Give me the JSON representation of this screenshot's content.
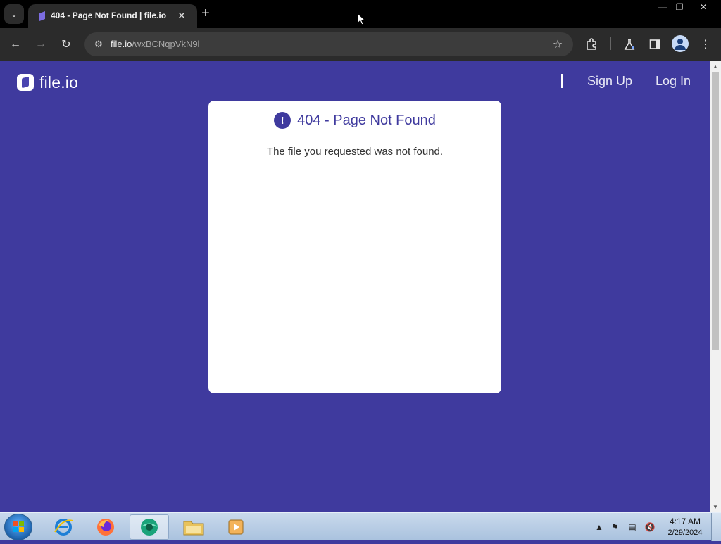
{
  "browser": {
    "tab_title": "404 - Page Not Found | file.io",
    "url_host": "file.io",
    "url_path": "/wxBCNqpVkN9l"
  },
  "site": {
    "logo_text": "file.io",
    "nav": {
      "sign_up": "Sign Up",
      "log_in": "Log In"
    },
    "error": {
      "icon_glyph": "!",
      "title": "404 - Page Not Found",
      "message": "The file you requested was not found."
    },
    "colors": {
      "brand_background": "#3f3a9e",
      "card_background": "#ffffff"
    }
  },
  "taskbar": {
    "apps": [
      "internet-explorer",
      "firefox",
      "browser-active",
      "file-explorer",
      "media-player"
    ],
    "clock": {
      "time": "4:17 AM",
      "date": "2/29/2024"
    }
  }
}
